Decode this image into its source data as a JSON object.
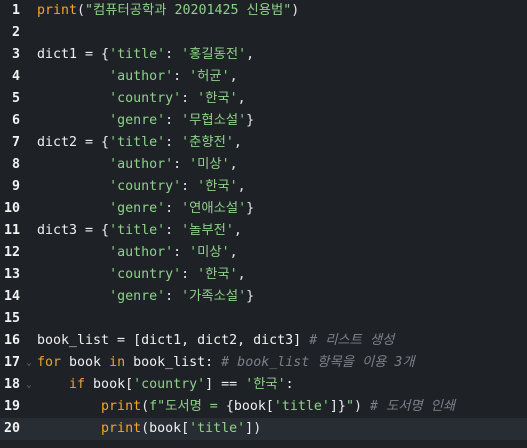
{
  "editor": {
    "language": "python",
    "theme": {
      "background": "#1e2126",
      "current_line": "#282c33",
      "keyword": "#e8a33b",
      "function": "#f5a623",
      "string": "#8fd18a",
      "comment": "#7c8088",
      "text": "#dedede"
    },
    "current_line": 20,
    "lines": [
      {
        "n": "1",
        "fold": false,
        "tokens": [
          [
            "fn",
            "print"
          ],
          [
            "punc",
            "("
          ],
          [
            "str",
            "\"컴퓨터공학과 20201425 신용범\""
          ],
          [
            "punc",
            ")"
          ]
        ]
      },
      {
        "n": "2",
        "fold": false,
        "tokens": []
      },
      {
        "n": "3",
        "fold": false,
        "tokens": [
          [
            "var",
            "dict1 = {"
          ],
          [
            "str",
            "'title'"
          ],
          [
            "punc",
            ": "
          ],
          [
            "str",
            "'홍길동전'"
          ],
          [
            "punc",
            ","
          ]
        ]
      },
      {
        "n": "4",
        "fold": false,
        "tokens": [
          [
            "var",
            "         "
          ],
          [
            "str",
            "'author'"
          ],
          [
            "punc",
            ": "
          ],
          [
            "str",
            "'허균'"
          ],
          [
            "punc",
            ","
          ]
        ]
      },
      {
        "n": "5",
        "fold": false,
        "tokens": [
          [
            "var",
            "         "
          ],
          [
            "str",
            "'country'"
          ],
          [
            "punc",
            ": "
          ],
          [
            "str",
            "'한국'"
          ],
          [
            "punc",
            ","
          ]
        ]
      },
      {
        "n": "6",
        "fold": false,
        "tokens": [
          [
            "var",
            "         "
          ],
          [
            "str",
            "'genre'"
          ],
          [
            "punc",
            ": "
          ],
          [
            "str",
            "'무협소설'"
          ],
          [
            "punc",
            "}"
          ]
        ]
      },
      {
        "n": "7",
        "fold": false,
        "tokens": [
          [
            "var",
            "dict2 = {"
          ],
          [
            "str",
            "'title'"
          ],
          [
            "punc",
            ": "
          ],
          [
            "str",
            "'춘향전'"
          ],
          [
            "punc",
            ","
          ]
        ]
      },
      {
        "n": "8",
        "fold": false,
        "tokens": [
          [
            "var",
            "         "
          ],
          [
            "str",
            "'author'"
          ],
          [
            "punc",
            ": "
          ],
          [
            "str",
            "'미상'"
          ],
          [
            "punc",
            ","
          ]
        ]
      },
      {
        "n": "9",
        "fold": false,
        "tokens": [
          [
            "var",
            "         "
          ],
          [
            "str",
            "'country'"
          ],
          [
            "punc",
            ": "
          ],
          [
            "str",
            "'한국'"
          ],
          [
            "punc",
            ","
          ]
        ]
      },
      {
        "n": "10",
        "fold": false,
        "tokens": [
          [
            "var",
            "         "
          ],
          [
            "str",
            "'genre'"
          ],
          [
            "punc",
            ": "
          ],
          [
            "str",
            "'연애소설'"
          ],
          [
            "punc",
            "}"
          ]
        ]
      },
      {
        "n": "11",
        "fold": false,
        "tokens": [
          [
            "var",
            "dict3 = {"
          ],
          [
            "str",
            "'title'"
          ],
          [
            "punc",
            ": "
          ],
          [
            "str",
            "'놀부전'"
          ],
          [
            "punc",
            ","
          ]
        ]
      },
      {
        "n": "12",
        "fold": false,
        "tokens": [
          [
            "var",
            "         "
          ],
          [
            "str",
            "'author'"
          ],
          [
            "punc",
            ": "
          ],
          [
            "str",
            "'미상'"
          ],
          [
            "punc",
            ","
          ]
        ]
      },
      {
        "n": "13",
        "fold": false,
        "tokens": [
          [
            "var",
            "         "
          ],
          [
            "str",
            "'country'"
          ],
          [
            "punc",
            ": "
          ],
          [
            "str",
            "'한국'"
          ],
          [
            "punc",
            ","
          ]
        ]
      },
      {
        "n": "14",
        "fold": false,
        "tokens": [
          [
            "var",
            "         "
          ],
          [
            "str",
            "'genre'"
          ],
          [
            "punc",
            ": "
          ],
          [
            "str",
            "'가족소설'"
          ],
          [
            "punc",
            "}"
          ]
        ]
      },
      {
        "n": "15",
        "fold": false,
        "tokens": []
      },
      {
        "n": "16",
        "fold": false,
        "tokens": [
          [
            "var",
            "book_list = [dict1, dict2, dict3] "
          ],
          [
            "cmt",
            "# 리스트 생성"
          ]
        ]
      },
      {
        "n": "17",
        "fold": true,
        "tokens": [
          [
            "kw",
            "for"
          ],
          [
            "var",
            " book "
          ],
          [
            "kw",
            "in"
          ],
          [
            "var",
            " book_list: "
          ],
          [
            "cmt",
            "# book_list 항목을 이용 3개"
          ]
        ]
      },
      {
        "n": "18",
        "fold": true,
        "tokens": [
          [
            "var",
            "    "
          ],
          [
            "kw",
            "if"
          ],
          [
            "var",
            " book["
          ],
          [
            "str",
            "'country'"
          ],
          [
            "var",
            "] == "
          ],
          [
            "str",
            "'한국'"
          ],
          [
            "var",
            ":"
          ]
        ]
      },
      {
        "n": "19",
        "fold": false,
        "tokens": [
          [
            "var",
            "        "
          ],
          [
            "fn",
            "print"
          ],
          [
            "punc",
            "("
          ],
          [
            "str",
            "f\"도서명 = "
          ],
          [
            "var",
            "{book["
          ],
          [
            "str",
            "'title'"
          ],
          [
            "var",
            "]}"
          ],
          [
            "str",
            "\""
          ],
          [
            "punc",
            ") "
          ],
          [
            "cmt",
            "# 도서명 인쇄"
          ]
        ]
      },
      {
        "n": "20",
        "fold": false,
        "tokens": [
          [
            "var",
            "        "
          ],
          [
            "fn",
            "print"
          ],
          [
            "punc",
            "("
          ],
          [
            "var",
            "book["
          ],
          [
            "str",
            "'title'"
          ],
          [
            "var",
            "]"
          ],
          [
            "punc",
            ")"
          ]
        ]
      }
    ]
  },
  "icons": {
    "fold_marker": "chevron-down-icon"
  }
}
